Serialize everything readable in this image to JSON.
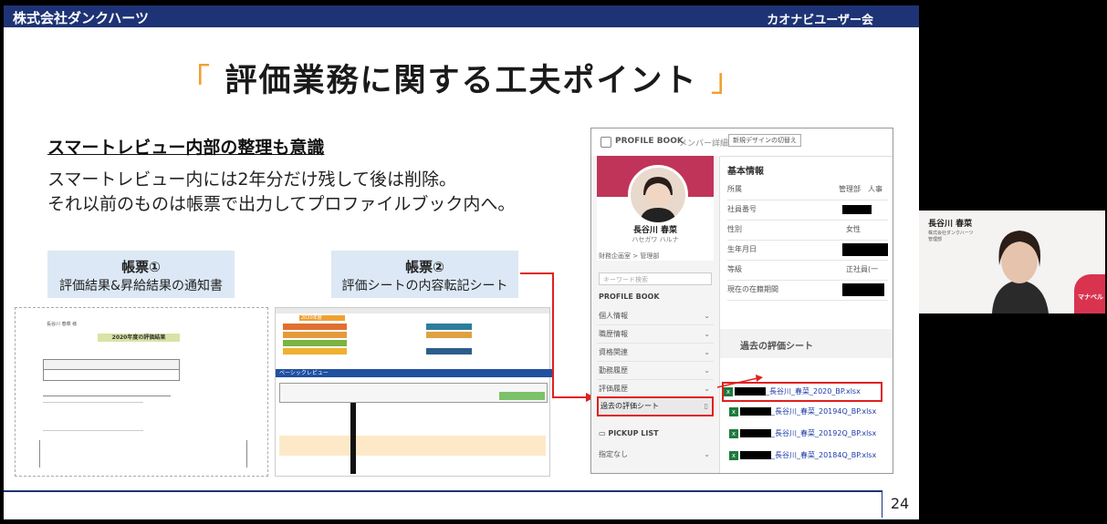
{
  "header": {
    "company": "株式会社ダンクハーツ",
    "event": "カオナビユーザー会"
  },
  "title": {
    "open_bracket": "「",
    "text": "評価業務に関する工夫ポイント",
    "close_bracket": "」"
  },
  "section": {
    "heading": "スマートレビュー内部の整理も意識",
    "line1": "スマートレビュー内には2年分だけ残して後は削除。",
    "line2": "それ以前のものは帳票で出力してプロファイルブック内へ。"
  },
  "form1": {
    "title": "帳票①",
    "desc": "評価結果&昇給結果の通知書",
    "doc_title": "2020年度の評価結果",
    "doc_name": "長谷川 春菜 様"
  },
  "form2": {
    "title": "帳票②",
    "desc": "評価シートの内容転記シート",
    "sheet_title": "ベーシックレビュー",
    "sheet_year": "2020年度"
  },
  "profile_book": {
    "header_title": "PROFILE BOOK",
    "header_crumb": "メンバー詳細",
    "header_button": "新規デザインの切替え",
    "person_name": "長谷川 春菜",
    "person_kana": "ハセガワ ハルナ",
    "person_dept": "財務企画室 > 管理部",
    "search_placeholder": "キーワード検索",
    "section_label": "PROFILE BOOK",
    "nav": [
      "個人情報",
      "職歴情報",
      "資格関連",
      "勤務履歴",
      "評価履歴",
      "過去の評価シート"
    ],
    "pickup_label": "PICKUP LIST",
    "pickup_value": "指定なし",
    "basic_info_title": "基本情報",
    "info_rows": [
      {
        "label": "所属",
        "value": "管理部　人事"
      },
      {
        "label": "社員番号",
        "value": ""
      },
      {
        "label": "性別",
        "value": "女性"
      },
      {
        "label": "生年月日",
        "value": ""
      },
      {
        "label": "等級",
        "value": "正社員(一般)"
      },
      {
        "label": "現在の在籍期間",
        "value": ""
      }
    ],
    "past_sheets_title": "過去の評価シート",
    "files": [
      "_長谷川_春菜_2020_BP.xlsx",
      "_長谷川_春菜_20194Q_BP.xlsx",
      "_長谷川_春菜_20192Q_BP.xlsx",
      "_長谷川_春菜_20184Q_BP.xlsx"
    ]
  },
  "page_number": "24",
  "video": {
    "name": "長谷川 春菜",
    "company": "株式会社ダンクハーツ",
    "role": "管理部",
    "logo": "マナベル"
  },
  "colors": {
    "header_bg": "#1e3375",
    "accent_bracket": "#f0a030",
    "highlight_red": "#e02020",
    "form_box_bg": "#dce8f5"
  }
}
